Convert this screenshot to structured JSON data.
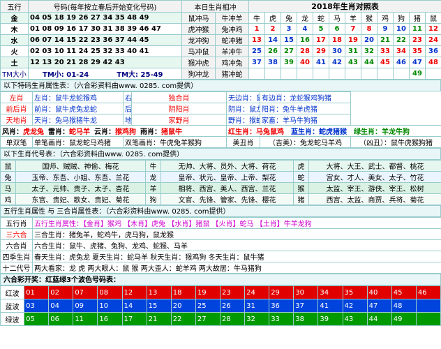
{
  "top": {
    "header": {
      "col1": "五行",
      "col2": "号码(每年按立春后开始变化号码)",
      "col3": "本日生肖相冲",
      "col4": "2018年生肖对照表"
    },
    "rows": [
      {
        "el": "金",
        "nums": "04 05 18 19 26 27 34 35 48 49",
        "p1": "鼠冲马",
        "p2": "牛冲羊"
      },
      {
        "el": "木",
        "nums": "01 08 09 16 17 30 31 38 39 46 47",
        "p1": "虎冲猴",
        "p2": "兔冲鸡"
      },
      {
        "el": "水",
        "nums": "06 07 14 15 22 23 36 37 44 45",
        "p1": "龙冲狗",
        "p2": "蛇冲猪"
      },
      {
        "el": "火",
        "nums": "02 03 10 11 24 25 32 33 40 41",
        "p1": "马冲鼠",
        "p2": "羊冲牛"
      },
      {
        "el": "土",
        "nums": "12 13 20 21 28 29 42 43",
        "p1": "猴冲虎",
        "p2": "鸡冲兔"
      },
      {
        "el": "",
        "nums": "",
        "p1": "狗冲龙",
        "p2": "猪冲蛇"
      }
    ],
    "tm_small_label": "TM大小",
    "tm_small": "TM小: 01-24",
    "tm_big": "TM大: 25-49",
    "zodiacs": [
      "牛",
      "虎",
      "兔",
      "龙",
      "蛇",
      "马",
      "羊",
      "猴",
      "鸡",
      "狗",
      "猪",
      "鼠"
    ],
    "zodiac_nums": [
      [
        "1",
        "2",
        "3",
        "4",
        "5",
        "6",
        "7",
        "8",
        "9",
        "10",
        "11",
        "12"
      ],
      [
        "13",
        "14",
        "15",
        "16",
        "17",
        "18",
        "19",
        "20",
        "21",
        "22",
        "23",
        "24"
      ],
      [
        "25",
        "26",
        "27",
        "28",
        "29",
        "30",
        "31",
        "32",
        "33",
        "34",
        "35",
        "36"
      ],
      [
        "37",
        "38",
        "39",
        "40",
        "41",
        "42",
        "43",
        "44",
        "45",
        "46",
        "47",
        "48"
      ],
      [
        "",
        "",
        "",
        "",
        "",
        "",
        "",
        "",
        "",
        "",
        "49",
        ""
      ]
    ],
    "zodiac_colors": [
      [
        "red",
        "red",
        "blue",
        "blue",
        "green",
        "green",
        "red",
        "red",
        "blue",
        "blue",
        "green",
        "red"
      ],
      [
        "red",
        "blue",
        "blue",
        "green",
        "red",
        "red",
        "red",
        "blue",
        "green",
        "green",
        "red",
        "red"
      ],
      [
        "blue",
        "green",
        "green",
        "red",
        "red",
        "blue",
        "green",
        "green",
        "red",
        "red",
        "red",
        "blue"
      ],
      [
        "blue",
        "blue",
        "green",
        "red",
        "blue",
        "blue",
        "green",
        "green",
        "red",
        "blue",
        "blue",
        "red"
      ],
      [
        "",
        "",
        "",
        "",
        "",
        "",
        "",
        "",
        "",
        "",
        "green",
        ""
      ]
    ]
  },
  "special": {
    "title": "以下特码生肖属性表：（六合彩资料由www. 0285. com提供）",
    "rows": [
      {
        "a": "左肖",
        "b": "左肖：鼠牛龙蛇猴鸡",
        "c": "右肖",
        "d": "右肖：虎兔马羊狗猪",
        "e": "独合肖",
        "f": "无边肖：鼠牛虎兔马羊",
        "g": "有边肖：龙蛇猴鸡狗猪"
      },
      {
        "a": "前后肖",
        "b": "前肖：鼠牛虎兔龙蛇",
        "c": "后肖",
        "d": "后肖：马羊猴鸡狗猪",
        "e": "阴阳肖",
        "f": "阴肖：鼠龙马蛇猴狗",
        "g": "阳肖：兔牛羊虎猪"
      },
      {
        "a": "天地肖",
        "b": "天肖：兔马猴猪牛龙",
        "c": "地肖",
        "d": "地肖：蛇羊鸡狗鼠虎",
        "e": "家野肖",
        "f": "野肖：猴蛇龙兔虎鼠",
        "g": "家畜：羊马牛狗猪"
      }
    ],
    "colorrow": [
      {
        "k": "风肖：",
        "v": "虎龙兔"
      },
      {
        "k": "雷肖：",
        "v": "蛇马羊"
      },
      {
        "k": "云肖：",
        "v": "猴鸡狗"
      },
      {
        "k": "雨肖：",
        "v": "猪鼠牛"
      }
    ],
    "colorrow2": [
      {
        "k": "红生肖：",
        "v": "马兔鼠鸡"
      },
      {
        "k": "蓝生肖：",
        "v": "蛇虎猪猴"
      },
      {
        "k": "绿生肖：",
        "v": "羊龙牛狗"
      }
    ],
    "pen": {
      "a": "单双笔",
      "b": "单笔画肖：鼠龙蛇马鸡猪",
      "c": "双笔画肖：牛虎兔羊猴狗",
      "e": "美丑肖",
      "f": "（吉美）：兔龙蛇马羊鸡",
      "g": "（凶丑）：鼠牛虎猴狗猪"
    }
  },
  "codes": {
    "title": "以下生肖代号表：（六合彩资料由www. 0285. com提供）",
    "rows": [
      {
        "z1": "鼠",
        "a": "国师、贼贼、神偷、梅花",
        "z2": "牛",
        "b": "无帅、大将、员外、大将、荷花",
        "z3": "虎",
        "c": "大将、大王、武士、都督、桃花"
      },
      {
        "z1": "兔",
        "a": "玉帝、东吾、小姐、东吾、兰花",
        "z2": "龙",
        "b": "皇帝、状元、皇帝、上帝、梨花",
        "z3": "蛇",
        "c": "宫女、才人、美女、太子、竹花"
      },
      {
        "z1": "马",
        "a": "太子、元帅、贵子、太子、杏花",
        "z2": "羊",
        "b": "相将、西宫、美人、西宫、兰花",
        "z3": "猴",
        "c": "太监、宰王、游侠、宰王、松树"
      },
      {
        "z1": "鸡",
        "a": "东宫、贵妃、歌女、贵妃、菊花",
        "z2": "狗",
        "b": "文官、先锋、管家、先锋、樱花",
        "z3": "猪",
        "c": "西宫、太监、商贾、兵将、菊花"
      }
    ]
  },
  "five": {
    "title": "五行生肖属性 与 三合肖属性表：（六合彩资料由www. 0285. com提供）",
    "rows": [
      {
        "k": "五行肖",
        "v": "五行生肖属性：【金肖】猴鸡 【木肖】虎兔 【水肖】猪鼠 【火肖】蛇马 【土肖】牛羊龙狗"
      },
      {
        "k": "三六合",
        "v": "三合生肖：猪兔羊，蛇鸡牛，虎马狗，鼠龙猴"
      },
      {
        "k": "六合肖",
        "v": "六合生肖：鼠牛、虎猪、兔狗、龙鸡、蛇猴、马羊"
      },
      {
        "k": "四季生肖",
        "v": "春天生肖：虎兔龙   夏天生肖：蛇马羊   秋天生肖：猴鸡狗   冬天生肖：鼠牛猪"
      },
      {
        "k": "十二代号",
        "v": "两大看家：龙 虎   两大眼人：鼠 猴   两大歪人：蛇羊鸡   两大故居：牛马猪狗"
      }
    ]
  },
  "waves": {
    "title": "六合彩开奖：红蓝绿3个波色号码表：",
    "rows": [
      {
        "label": "红波",
        "nums": [
          "01",
          "02",
          "07",
          "08",
          "12",
          "13",
          "18",
          "19",
          "23",
          "24",
          "29",
          "30",
          "34",
          "35",
          "40",
          "45",
          "46"
        ]
      },
      {
        "label": "蓝波",
        "nums": [
          "03",
          "04",
          "09",
          "10",
          "14",
          "15",
          "20",
          "25",
          "26",
          "31",
          "36",
          "37",
          "41",
          "42",
          "47",
          "48"
        ]
      },
      {
        "label": "绿波",
        "nums": [
          "05",
          "06",
          "11",
          "16",
          "17",
          "21",
          "22",
          "27",
          "28",
          "32",
          "33",
          "38",
          "39",
          "43",
          "44",
          "49"
        ]
      }
    ]
  }
}
